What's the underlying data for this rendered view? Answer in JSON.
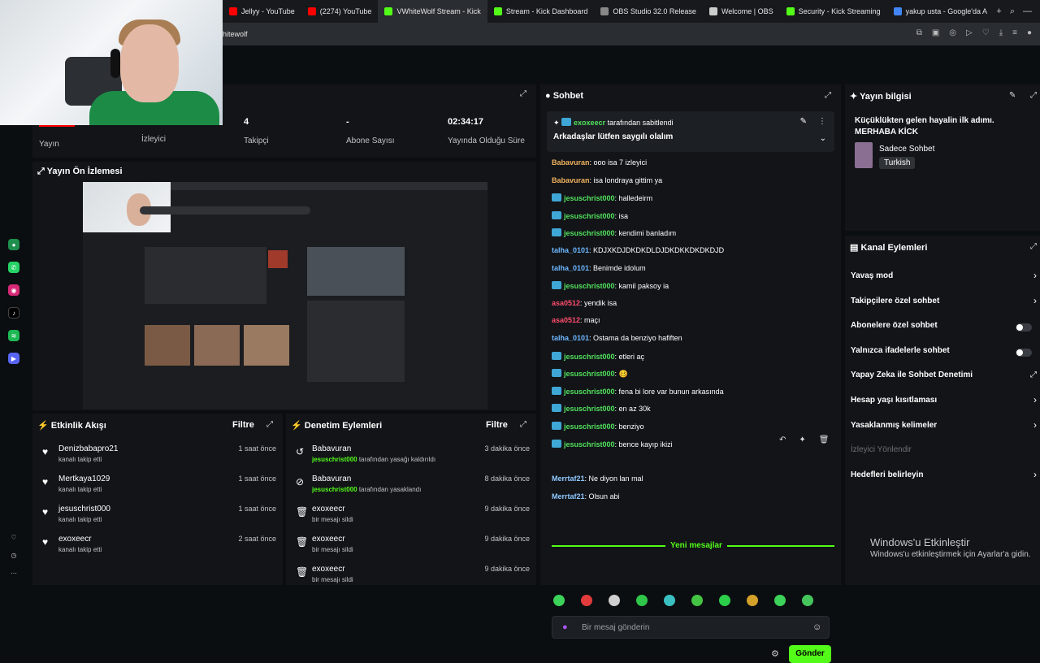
{
  "browser": {
    "tabs": [
      {
        "label": "Jellyy - YouTube",
        "color": "#ff0000"
      },
      {
        "label": "(2274) YouTube",
        "color": "#ff0000"
      },
      {
        "label": "VWhiteWolf Stream - Kick",
        "color": "#53fc18",
        "active": true
      },
      {
        "label": "Stream - Kick Dashboard",
        "color": "#53fc18"
      },
      {
        "label": "OBS Studio 32.0 Release",
        "color": "#888888"
      },
      {
        "label": "Welcome | OBS",
        "color": "#cccccc"
      },
      {
        "label": "Security - Kick Streaming",
        "color": "#53fc18"
      },
      {
        "label": "yakup usta - Google'da A",
        "color": "#4285f4"
      }
    ],
    "url": "hitewolf"
  },
  "stats": {
    "status_label": "Yayın",
    "viewers_label": "İzleyici",
    "followers_value": "4",
    "followers_label": "Takipçi",
    "subs_value": "-",
    "subs_label": "Abone Sayısı",
    "duration_value": "02:34:17",
    "duration_label": "Yayında Olduğu Süre"
  },
  "preview": {
    "title": "Yayın Ön İzlemesi",
    "status_color": "#ff0000"
  },
  "activity": {
    "title": "Etkinlik Akışı",
    "filter": "Filtre",
    "items": [
      {
        "name": "Denizbabapro21",
        "sub": "kanalı takip etti",
        "time": "1 saat önce"
      },
      {
        "name": "Mertkaya1029",
        "sub": "kanalı takip etti",
        "time": "1 saat önce"
      },
      {
        "name": "jesuschrist000",
        "sub": "kanalı takip etti",
        "time": "1 saat önce"
      },
      {
        "name": "exoxeecr",
        "sub": "kanalı takip etti",
        "time": "2 saat önce"
      }
    ]
  },
  "moderation": {
    "title": "Denetim Eylemleri",
    "filter": "Filtre",
    "items": [
      {
        "name": "Babavuran",
        "user": "jesuschrist000",
        "sub": " tarafından yasağı kaldırıldı",
        "time": "3 dakika önce"
      },
      {
        "name": "Babavuran",
        "user": "jesuschrist000",
        "sub": " tarafından yasaklandı",
        "time": "8 dakika önce"
      },
      {
        "name": "exoxeecr",
        "user": "",
        "sub": "bir mesajı sildi",
        "time": "9 dakika önce"
      },
      {
        "name": "exoxeecr",
        "user": "",
        "sub": "bir mesajı sildi",
        "time": "9 dakika önce"
      },
      {
        "name": "exoxeecr",
        "user": "",
        "sub": "bir mesajı sildi",
        "time": "9 dakika önce"
      }
    ]
  },
  "chat": {
    "title": "Sohbet",
    "pinned_by": "exoxeecr",
    "pinned_suffix": " tarafından sabitlendi",
    "pinned_text": "Arkadaşlar lütfen saygılı olalım",
    "messages": [
      {
        "user": "Babavuran",
        "text": ": ooo isa 7 izleyici"
      },
      {
        "user": "Babavuran",
        "text": ": isa londraya gittim ya"
      },
      {
        "user": "jesuschrist000",
        "text": ": halledeirm"
      },
      {
        "user": "jesuschrist000",
        "text": ": isa"
      },
      {
        "user": "jesuschrist000",
        "text": ": kendimi banladım"
      },
      {
        "user": "talha_0101",
        "text": ": KDJXKDJDKDKDLDJDKDKKDKDKDJD"
      },
      {
        "user": "talha_0101",
        "text": ": Benimde idolum"
      },
      {
        "user": "jesuschrist000",
        "text": ": kamil paksoy ia"
      },
      {
        "user": "asa0512",
        "text": ": yendik isa"
      },
      {
        "user": "asa0512",
        "text": ": maçı"
      },
      {
        "user": "talha_0101",
        "text": ": Ostama da benziyo hafiften"
      },
      {
        "user": "jesuschrist000",
        "text": ": etleri aç"
      },
      {
        "user": "jesuschrist000",
        "text": ": 🥴"
      },
      {
        "user": "jesuschrist000",
        "text": ": fena bi lore var bunun arkasında"
      },
      {
        "user": "jesuschrist000",
        "text": ": en az 30k"
      },
      {
        "user": "jesuschrist000",
        "text": ": benziyo"
      },
      {
        "user": "jesuschrist000",
        "text": ": bence kayıp ikizi"
      }
    ],
    "new_messages_label": "Yeni mesajlar",
    "new_messages": [
      {
        "user": "Merrtaf21",
        "text": ": Ne diyon lan mal"
      },
      {
        "user": "Merrtaf21",
        "text": ": Olsun abi"
      }
    ],
    "input_placeholder": "Bir mesaj gönderin",
    "send_label": "Gönder",
    "emote_colors": [
      "#3bd35a",
      "#e23b3b",
      "#cfcfcf",
      "#2fc64a",
      "#3ac0c0",
      "#43c443",
      "#2ccf4a",
      "#d4a12a",
      "#3bd35a",
      "#44c65c"
    ]
  },
  "stream_info": {
    "title": "Yayın bilgisi",
    "stream_title": "Küçüklükten gelen hayalin ilk adımı. MERHABA KİCK",
    "category": "Sadece Sohbet",
    "language": "Turkish"
  },
  "channel_actions": {
    "title": "Kanal Eylemleri",
    "items": [
      {
        "label": "Yavaş mod",
        "control": "chevron"
      },
      {
        "label": "Takipçilere özel sohbet",
        "control": "chevron"
      },
      {
        "label": "Abonelere özel sohbet",
        "control": "toggle"
      },
      {
        "label": "Yalnızca ifadelerle sohbet",
        "control": "toggle"
      },
      {
        "label": "Yapay Zeka ile Sohbet Denetimi",
        "control": "external"
      },
      {
        "label": "Hesap yaşı kısıtlaması",
        "control": "chevron"
      },
      {
        "label": "Yasaklanmış kelimeler",
        "control": "chevron"
      },
      {
        "label": "İzleyici Yönlendir",
        "control": "none",
        "disabled": true
      },
      {
        "label": "Hedefleri belirleyin",
        "control": "chevron"
      }
    ]
  },
  "watermark": {
    "title": "Windows'u Etkinleştir",
    "sub": "Windows'u etkinleştirmek için Ayarlar'a gidin."
  }
}
